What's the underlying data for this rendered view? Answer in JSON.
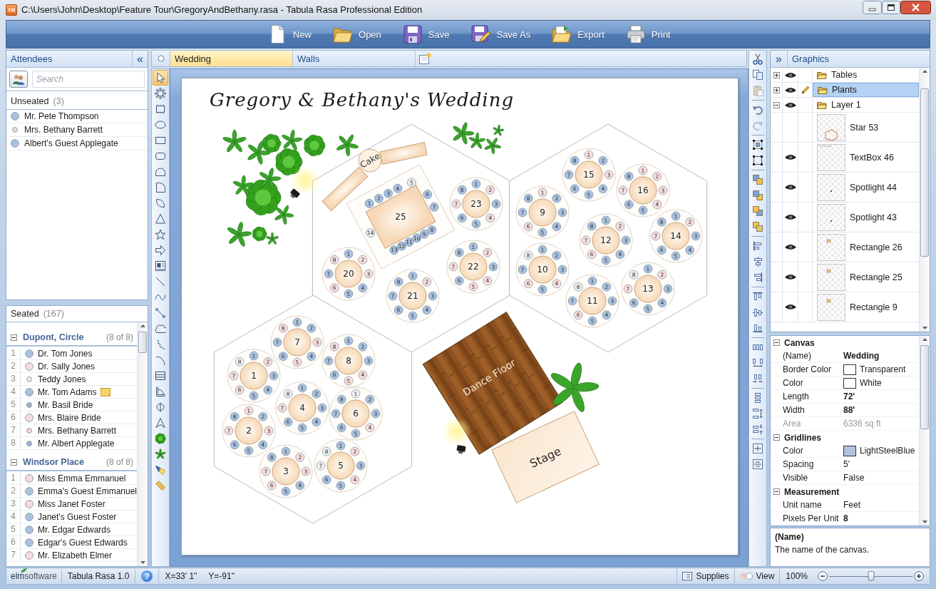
{
  "window": {
    "logo": "TR",
    "title": "C:\\Users\\John\\Desktop\\Feature Tour\\GregoryAndBethany.rasa - Tabula Rasa Professional Edition"
  },
  "toolbar": [
    {
      "kind": "new",
      "label": "New"
    },
    {
      "kind": "open",
      "label": "Open"
    },
    {
      "kind": "save",
      "label": "Save"
    },
    {
      "kind": "save-as",
      "label": "Save As"
    },
    {
      "kind": "export",
      "label": "Export"
    },
    {
      "kind": "print",
      "label": "Print"
    }
  ],
  "attendees": {
    "title": "Attendees",
    "collapse": "«",
    "search": {
      "placeholder": "Search"
    },
    "unseated": {
      "label": "Unseated",
      "count": "(3)",
      "people": [
        {
          "name": "Mr. Pete Thompson",
          "kind": "large",
          "color": "#a9c1de"
        },
        {
          "name": "Mrs. Bethany Barrett",
          "kind": "small",
          "color": "#f6d6d6"
        },
        {
          "name": "Albert's Guest Applegate",
          "kind": "large",
          "color": "#a9c1de"
        }
      ]
    },
    "seated": {
      "label": "Seated",
      "count": "(167)",
      "groups": [
        {
          "name": "Dupont, Circle",
          "count": "(8 of 8)",
          "expanded": true,
          "guests": [
            {
              "number": "1",
              "name": "Dr. Tom Jones",
              "kind": "large",
              "color": "#a9c1de",
              "note": false
            },
            {
              "number": "2",
              "name": "Dr. Sally Jones",
              "kind": "large",
              "color": "#f8dcdc",
              "note": false
            },
            {
              "number": "3",
              "name": "Teddy Jones",
              "kind": "small",
              "color": "#f2eaea",
              "note": false
            },
            {
              "number": "4",
              "name": "Mr. Tom Adams",
              "kind": "large",
              "color": "#a9c1de",
              "note": true
            },
            {
              "number": "5",
              "name": "Mr. Basil Bride",
              "kind": "small",
              "color": "#9db3cf",
              "note": false
            },
            {
              "number": "6",
              "name": "Mrs. Blaire Bride",
              "kind": "large",
              "color": "#f8dcdc",
              "note": false
            },
            {
              "number": "7",
              "name": "Mrs. Bethany Barrett",
              "kind": "small",
              "color": "#f6d6d6",
              "note": false
            },
            {
              "number": "8",
              "name": "Mr. Albert Applegate",
              "kind": "small",
              "color": "#9db3cf",
              "note": false
            }
          ]
        },
        {
          "name": "Windsor Place",
          "count": "(8 of 8)",
          "expanded": true,
          "guests": [
            {
              "number": "1",
              "name": "Miss Emma Emmanuel",
              "kind": "large",
              "color": "#f8dcdc",
              "note": false
            },
            {
              "number": "2",
              "name": "Emma's Guest Emmanuel",
              "kind": "large",
              "color": "#a9c1de",
              "note": false
            },
            {
              "number": "3",
              "name": "Miss Janet Foster",
              "kind": "large",
              "color": "#f8dcdc",
              "note": false
            },
            {
              "number": "4",
              "name": "Janet's Guest Foster",
              "kind": "large",
              "color": "#a9c1de",
              "note": false
            },
            {
              "number": "5",
              "name": "Mr. Edgar Edwards",
              "kind": "large",
              "color": "#a9c1de",
              "note": false
            },
            {
              "number": "6",
              "name": "Edgar's Guest Edwards",
              "kind": "large",
              "color": "#a9c1de",
              "note": false
            },
            {
              "number": "7",
              "name": "Mr. Elizabeth Elmer",
              "kind": "large",
              "color": "#f8dcdc",
              "note": false
            }
          ]
        }
      ]
    }
  },
  "tabs": [
    {
      "label": "Wedding",
      "selected": true
    },
    {
      "label": "Walls",
      "selected": false
    }
  ],
  "tools": [
    {
      "kind": "pointer",
      "selected": true
    },
    {
      "kind": "round-table",
      "selected": false
    },
    {
      "kind": "rect-table",
      "selected": false
    },
    {
      "kind": "ellipse",
      "selected": false
    },
    {
      "kind": "rectangle",
      "selected": false
    },
    {
      "kind": "rounded-rectangle",
      "selected": false
    },
    {
      "kind": "dome",
      "selected": false
    },
    {
      "kind": "d-shape",
      "selected": false
    },
    {
      "kind": "segment",
      "selected": false
    },
    {
      "kind": "triangle",
      "selected": false
    },
    {
      "kind": "star",
      "selected": false
    },
    {
      "kind": "arrow",
      "selected": false
    },
    {
      "kind": "textbox",
      "selected": false
    },
    {
      "kind": "line",
      "selected": false
    },
    {
      "kind": "curve",
      "selected": false
    },
    {
      "kind": "connector",
      "selected": false
    },
    {
      "kind": "cloud",
      "selected": false
    },
    {
      "kind": "squiggle",
      "selected": false
    },
    {
      "kind": "arc",
      "selected": false
    },
    {
      "kind": "stack",
      "selected": false
    },
    {
      "kind": "dimension",
      "selected": false
    },
    {
      "kind": "pipe",
      "selected": false
    },
    {
      "kind": "open-triangle",
      "selected": false
    },
    {
      "kind": "bush",
      "selected": false
    },
    {
      "kind": "palm",
      "selected": false
    },
    {
      "kind": "spotlight",
      "selected": false
    },
    {
      "kind": "ruler",
      "selected": false
    }
  ],
  "canvas": {
    "title": "Gregory & Bethany's Wedding",
    "tables": [
      {
        "number": "15",
        "kind": "round",
        "seats": [
          {
            "label": "1",
            "color": "#f8dcdc"
          },
          {
            "label": "2",
            "color": "#a9c1de"
          },
          {
            "label": "3",
            "color": "#f8dcdc"
          },
          {
            "label": "4",
            "color": "#a9c1de"
          },
          {
            "label": "5",
            "color": "#a9c1de"
          },
          {
            "label": "6",
            "color": "#a9c1de"
          },
          {
            "label": "7",
            "color": "#a9c1de"
          },
          {
            "label": "8",
            "color": "#a9c1de"
          }
        ]
      },
      {
        "number": "16",
        "kind": "round",
        "seats": [
          {
            "label": "1",
            "color": "#f8dcdc"
          },
          {
            "label": "2",
            "color": "#f8dcdc"
          },
          {
            "label": "3",
            "color": "#f8dcdc"
          },
          {
            "label": "4",
            "color": "#f8dcdc"
          },
          {
            "label": "5",
            "color": "#a9c1de"
          },
          {
            "label": "6",
            "color": "#a9c1de"
          },
          {
            "label": "7",
            "color": "#f8dcdc"
          },
          {
            "label": "8",
            "color": "#a9c1de"
          }
        ]
      },
      {
        "number": "25",
        "kind": "rectangle",
        "seats": [
          {
            "label": "1",
            "color": "#a9c1de"
          },
          {
            "label": "2",
            "color": "#a9c1de"
          },
          {
            "label": "3",
            "color": "#a9c1de"
          },
          {
            "label": "4",
            "color": "#a9c1de"
          },
          {
            "label": "5",
            "color": "#eeeeee"
          },
          {
            "label": "6",
            "color": "#a9c1de"
          },
          {
            "label": "7",
            "color": "#a9c1de"
          },
          {
            "label": "8",
            "color": "#a9c1de"
          },
          {
            "label": "9",
            "color": "#a9c1de"
          },
          {
            "label": "10",
            "color": "#a9c1de"
          },
          {
            "label": "11",
            "color": "#a9c1de"
          },
          {
            "label": "12",
            "color": "#a9c1de"
          },
          {
            "label": "13",
            "color": "#a9c1de"
          },
          {
            "label": "14",
            "color": "#eeeeee"
          }
        ]
      },
      {
        "number": "23",
        "kind": "round",
        "seats": [
          {
            "label": "1",
            "color": "#a9c1de"
          },
          {
            "label": "2",
            "color": "#f8dcdc"
          },
          {
            "label": "3",
            "color": "#a9c1de"
          },
          {
            "label": "4",
            "color": "#f8dcdc"
          },
          {
            "label": "5",
            "color": "#a9c1de"
          },
          {
            "label": "6",
            "color": "#a9c1de"
          },
          {
            "label": "7",
            "color": "#f8dcdc"
          },
          {
            "label": "8",
            "color": "#a9c1de"
          }
        ]
      },
      {
        "number": "9",
        "kind": "round",
        "seats": [
          {
            "label": "1",
            "color": "#f8dcdc"
          },
          {
            "label": "2",
            "color": "#a9c1de"
          },
          {
            "label": "3",
            "color": "#a9c1de"
          },
          {
            "label": "4",
            "color": "#a9c1de"
          },
          {
            "label": "5",
            "color": "#a9c1de"
          },
          {
            "label": "6",
            "color": "#f8dcdc"
          },
          {
            "label": "7",
            "color": "#a9c1de"
          },
          {
            "label": "8",
            "color": "#a9c1de"
          }
        ]
      },
      {
        "number": "14",
        "kind": "round",
        "seats": [
          {
            "label": "1",
            "color": "#a9c1de"
          },
          {
            "label": "2",
            "color": "#f8dcdc"
          },
          {
            "label": "3",
            "color": "#a9c1de"
          },
          {
            "label": "4",
            "color": "#a9c1de"
          },
          {
            "label": "5",
            "color": "#a9c1de"
          },
          {
            "label": "6",
            "color": "#a9c1de"
          },
          {
            "label": "7",
            "color": "#f8dcdc"
          },
          {
            "label": "8",
            "color": "#a9c1de"
          }
        ]
      },
      {
        "number": "12",
        "kind": "round",
        "seats": [
          {
            "label": "1",
            "color": "#a9c1de"
          },
          {
            "label": "2",
            "color": "#f8dcdc"
          },
          {
            "label": "3",
            "color": "#a9c1de"
          },
          {
            "label": "4",
            "color": "#a9c1de"
          },
          {
            "label": "5",
            "color": "#a9c1de"
          },
          {
            "label": "6",
            "color": "#f8dcdc"
          },
          {
            "label": "7",
            "color": "#f8dcdc"
          },
          {
            "label": "8",
            "color": "#a9c1de"
          }
        ]
      },
      {
        "number": "22",
        "kind": "round",
        "seats": [
          {
            "label": "1",
            "color": "#a9c1de"
          },
          {
            "label": "2",
            "color": "#f8dcdc"
          },
          {
            "label": "3",
            "color": "#a9c1de"
          },
          {
            "label": "4",
            "color": "#f8dcdc"
          },
          {
            "label": "5",
            "color": "#f8dcdc"
          },
          {
            "label": "6",
            "color": "#a9c1de"
          },
          {
            "label": "7",
            "color": "#f8dcdc"
          },
          {
            "label": "8",
            "color": "#a9c1de"
          }
        ]
      },
      {
        "number": "10",
        "kind": "round",
        "seats": [
          {
            "label": "1",
            "color": "#a9c1de"
          },
          {
            "label": "2",
            "color": "#a9c1de"
          },
          {
            "label": "3",
            "color": "#a9c1de"
          },
          {
            "label": "4",
            "color": "#f8dcdc"
          },
          {
            "label": "5",
            "color": "#a9c1de"
          },
          {
            "label": "6",
            "color": "#f8dcdc"
          },
          {
            "label": "7",
            "color": "#a9c1de"
          },
          {
            "label": "8",
            "color": "#eeeeee"
          }
        ]
      },
      {
        "number": "20",
        "kind": "round",
        "seats": [
          {
            "label": "1",
            "color": "#a9c1de"
          },
          {
            "label": "2",
            "color": "#f8dcdc"
          },
          {
            "label": "3",
            "color": "#f8dcdc"
          },
          {
            "label": "4",
            "color": "#a9c1de"
          },
          {
            "label": "5",
            "color": "#a9c1de"
          },
          {
            "label": "6",
            "color": "#f8dcdc"
          },
          {
            "label": "7",
            "color": "#a9c1de"
          },
          {
            "label": "8",
            "color": "#f8dcdc"
          }
        ]
      },
      {
        "number": "13",
        "kind": "round",
        "seats": [
          {
            "label": "1",
            "color": "#a9c1de"
          },
          {
            "label": "2",
            "color": "#f8dcdc"
          },
          {
            "label": "3",
            "color": "#a9c1de"
          },
          {
            "label": "4",
            "color": "#a9c1de"
          },
          {
            "label": "5",
            "color": "#a9c1de"
          },
          {
            "label": "6",
            "color": "#a9c1de"
          },
          {
            "label": "7",
            "color": "#f8dcdc"
          },
          {
            "label": "8",
            "color": "#eeeeee"
          }
        ]
      },
      {
        "number": "21",
        "kind": "round",
        "seats": [
          {
            "label": "1",
            "color": "#a9c1de"
          },
          {
            "label": "2",
            "color": "#f8dcdc"
          },
          {
            "label": "3",
            "color": "#a9c1de"
          },
          {
            "label": "4",
            "color": "#a9c1de"
          },
          {
            "label": "5",
            "color": "#a9c1de"
          },
          {
            "label": "6",
            "color": "#a9c1de"
          },
          {
            "label": "7",
            "color": "#a9c1de"
          },
          {
            "label": "8",
            "color": "#a9c1de"
          }
        ]
      },
      {
        "number": "11",
        "kind": "round",
        "seats": [
          {
            "label": "1",
            "color": "#a9c1de"
          },
          {
            "label": "2",
            "color": "#a9c1de"
          },
          {
            "label": "3",
            "color": "#a9c1de"
          },
          {
            "label": "4",
            "color": "#a9c1de"
          },
          {
            "label": "5",
            "color": "#a9c1de"
          },
          {
            "label": "6",
            "color": "#f8dcdc"
          },
          {
            "label": "7",
            "color": "#a9c1de"
          },
          {
            "label": "8",
            "color": "#eeeeee"
          }
        ]
      },
      {
        "number": "7",
        "kind": "round",
        "seats": [
          {
            "label": "1",
            "color": "#a9c1de"
          },
          {
            "label": "2",
            "color": "#a9c1de"
          },
          {
            "label": "3",
            "color": "#f8dcdc"
          },
          {
            "label": "4",
            "color": "#a9c1de"
          },
          {
            "label": "5",
            "color": "#f8dcdc"
          },
          {
            "label": "6",
            "color": "#a9c1de"
          },
          {
            "label": "7",
            "color": "#a9c1de"
          },
          {
            "label": "8",
            "color": "#f8dcdc"
          }
        ]
      },
      {
        "number": "8",
        "kind": "round",
        "seats": [
          {
            "label": "1",
            "color": "#a9c1de"
          },
          {
            "label": "2",
            "color": "#a9c1de"
          },
          {
            "label": "3",
            "color": "#a9c1de"
          },
          {
            "label": "4",
            "color": "#f8dcdc"
          },
          {
            "label": "5",
            "color": "#f8dcdc"
          },
          {
            "label": "6",
            "color": "#a9c1de"
          },
          {
            "label": "7",
            "color": "#a9c1de"
          },
          {
            "label": "8",
            "color": "#f8dcdc"
          }
        ]
      },
      {
        "number": "1",
        "kind": "round",
        "seats": [
          {
            "label": "1",
            "color": "#a9c1de"
          },
          {
            "label": "2",
            "color": "#f8dcdc"
          },
          {
            "label": "3",
            "color": "#a9c1de"
          },
          {
            "label": "4",
            "color": "#a9c1de"
          },
          {
            "label": "5",
            "color": "#a9c1de"
          },
          {
            "label": "6",
            "color": "#f8dcdc"
          },
          {
            "label": "7",
            "color": "#f8dcdc"
          },
          {
            "label": "8",
            "color": "#eeeeee"
          }
        ]
      },
      {
        "number": "4",
        "kind": "round",
        "seats": [
          {
            "label": "1",
            "color": "#a9c1de"
          },
          {
            "label": "2",
            "color": "#a9c1de"
          },
          {
            "label": "3",
            "color": "#a9c1de"
          },
          {
            "label": "4",
            "color": "#a9c1de"
          },
          {
            "label": "5",
            "color": "#a9c1de"
          },
          {
            "label": "6",
            "color": "#a9c1de"
          },
          {
            "label": "7",
            "color": "#f8dcdc"
          },
          {
            "label": "8",
            "color": "#eeeeee"
          }
        ]
      },
      {
        "number": "6",
        "kind": "round",
        "seats": [
          {
            "label": "1",
            "color": "#eeeeee"
          },
          {
            "label": "2",
            "color": "#a9c1de"
          },
          {
            "label": "3",
            "color": "#a9c1de"
          },
          {
            "label": "4",
            "color": "#f8dcdc"
          },
          {
            "label": "5",
            "color": "#a9c1de"
          },
          {
            "label": "6",
            "color": "#a9c1de"
          },
          {
            "label": "7",
            "color": "#a9c1de"
          },
          {
            "label": "8",
            "color": "#a9c1de"
          }
        ]
      },
      {
        "number": "2",
        "kind": "round",
        "seats": [
          {
            "label": "1",
            "color": "#f8dcdc"
          },
          {
            "label": "2",
            "color": "#a9c1de"
          },
          {
            "label": "3",
            "color": "#f8dcdc"
          },
          {
            "label": "4",
            "color": "#a9c1de"
          },
          {
            "label": "5",
            "color": "#a9c1de"
          },
          {
            "label": "6",
            "color": "#a9c1de"
          },
          {
            "label": "7",
            "color": "#f8dcdc"
          },
          {
            "label": "8",
            "color": "#a9c1de"
          }
        ]
      },
      {
        "number": "5",
        "kind": "round",
        "seats": [
          {
            "label": "1",
            "color": "#a9c1de"
          },
          {
            "label": "2",
            "color": "#f8dcdc"
          },
          {
            "label": "3",
            "color": "#a9c1de"
          },
          {
            "label": "4",
            "color": "#f8dcdc"
          },
          {
            "label": "5",
            "color": "#a9c1de"
          },
          {
            "label": "6",
            "color": "#a9c1de"
          },
          {
            "label": "7",
            "color": "#eeeeee"
          },
          {
            "label": "8",
            "color": "#eeeeee"
          }
        ]
      },
      {
        "number": "3",
        "kind": "round",
        "seats": [
          {
            "label": "1",
            "color": "#a9c1de"
          },
          {
            "label": "2",
            "color": "#f8dcdc"
          },
          {
            "label": "3",
            "color": "#f8dcdc"
          },
          {
            "label": "4",
            "color": "#a9c1de"
          },
          {
            "label": "5",
            "color": "#a9c1de"
          },
          {
            "label": "6",
            "color": "#f8dcdc"
          },
          {
            "label": "7",
            "color": "#f8dcdc"
          },
          {
            "label": "8",
            "color": "#a9c1de"
          }
        ]
      }
    ],
    "objects": [
      {
        "kind": "cake",
        "label": "Cake"
      },
      {
        "kind": "dance-floor",
        "label": "Dance Floor"
      },
      {
        "kind": "stage",
        "label": "Stage"
      }
    ]
  },
  "edit_tools": [
    [
      {
        "kind": "cut",
        "disabled": false
      },
      {
        "kind": "copy",
        "disabled": false
      },
      {
        "kind": "paste",
        "disabled": true
      }
    ],
    [
      {
        "kind": "undo",
        "disabled": false
      },
      {
        "kind": "redo",
        "disabled": true
      }
    ],
    [
      {
        "kind": "group",
        "disabled": false
      },
      {
        "kind": "ungroup",
        "disabled": false
      }
    ],
    [
      {
        "kind": "bring-front",
        "disabled": false
      },
      {
        "kind": "send-back",
        "disabled": false
      },
      {
        "kind": "bring-forward",
        "disabled": false
      },
      {
        "kind": "send-backward",
        "disabled": false
      }
    ],
    [
      {
        "kind": "align-left",
        "disabled": false
      },
      {
        "kind": "align-center",
        "disabled": false
      },
      {
        "kind": "align-right",
        "disabled": false
      }
    ],
    [
      {
        "kind": "align-top",
        "disabled": false
      },
      {
        "kind": "align-middle",
        "disabled": false
      },
      {
        "kind": "align-bottom",
        "disabled": false
      }
    ],
    [
      {
        "kind": "space-h",
        "disabled": false
      },
      {
        "kind": "space-h-grow",
        "disabled": false
      },
      {
        "kind": "space-h-shrink",
        "disabled": false
      }
    ],
    [
      {
        "kind": "space-v",
        "disabled": false
      },
      {
        "kind": "space-v-grow",
        "disabled": false
      },
      {
        "kind": "space-v-shrink",
        "disabled": false
      }
    ],
    [
      {
        "kind": "same-width",
        "disabled": false
      },
      {
        "kind": "same-height",
        "disabled": false
      }
    ]
  ],
  "graphics": {
    "title": "Graphics",
    "expand": "»",
    "layers": [
      {
        "name": "Tables",
        "expanded": false,
        "visible": true,
        "editing": false,
        "selected": false
      },
      {
        "name": "Plants",
        "expanded": false,
        "visible": true,
        "editing": true,
        "selected": true
      },
      {
        "name": "Layer 1",
        "expanded": true,
        "visible": true,
        "editing": false,
        "selected": false,
        "children": [
          {
            "name": "Star 53",
            "kind": "hexagon",
            "visible": false,
            "selected": false
          },
          {
            "name": "TextBox 46",
            "kind": "line",
            "visible": true,
            "selected": false
          },
          {
            "name": "Spotlight 44",
            "kind": "dot",
            "visible": true,
            "selected": false
          },
          {
            "name": "Spotlight 43",
            "kind": "dot",
            "visible": true,
            "selected": false
          },
          {
            "name": "Rectangle 26",
            "kind": "square",
            "visible": true,
            "selected": false
          },
          {
            "name": "Rectangle 25",
            "kind": "square",
            "visible": true,
            "selected": false
          },
          {
            "name": "Rectangle 9",
            "kind": "square",
            "visible": true,
            "selected": false
          }
        ]
      }
    ]
  },
  "properties": {
    "categories": [
      {
        "name": "Canvas",
        "expanded": true,
        "rows": [
          {
            "name": "(Name)",
            "value": "Wedding",
            "bold": true,
            "disabled": false
          },
          {
            "name": "Border Color",
            "value": "Transparent",
            "color": "#ffffff",
            "bold": false,
            "disabled": false
          },
          {
            "name": "Color",
            "value": "White",
            "color": "#ffffff",
            "bold": false,
            "disabled": false
          },
          {
            "name": "Length",
            "value": "72'",
            "bold": true,
            "disabled": false
          },
          {
            "name": "Width",
            "value": "88'",
            "bold": true,
            "disabled": false
          },
          {
            "name": "Area",
            "value": "6336 sq ft",
            "bold": false,
            "disabled": true
          }
        ]
      },
      {
        "name": "Gridlines",
        "expanded": true,
        "rows": [
          {
            "name": "Color",
            "value": "LightSteelBlue",
            "color": "#b0c4de",
            "bold": false,
            "disabled": false
          },
          {
            "name": "Spacing",
            "value": "5'",
            "bold": false,
            "disabled": false
          },
          {
            "name": "Visible",
            "value": "False",
            "bold": false,
            "disabled": false
          }
        ]
      },
      {
        "name": "Measurement",
        "expanded": true,
        "rows": [
          {
            "name": "Unit name",
            "value": "Feet",
            "bold": false,
            "disabled": false
          },
          {
            "name": "Pixels Per Unit",
            "value": "8",
            "bold": true,
            "disabled": false
          }
        ]
      }
    ],
    "description": {
      "title": "(Name)",
      "text": "The name of the canvas."
    }
  },
  "status_bar": {
    "brand": "**elm**software",
    "product": "Tabula Rasa 1.0",
    "help": "?",
    "x": "X=33' 1\"",
    "y": "Y=-91\"",
    "supplies": "Supplies",
    "view": "View",
    "zoom": "100%",
    "zoom_slider": {
      "level": 0.5
    }
  }
}
